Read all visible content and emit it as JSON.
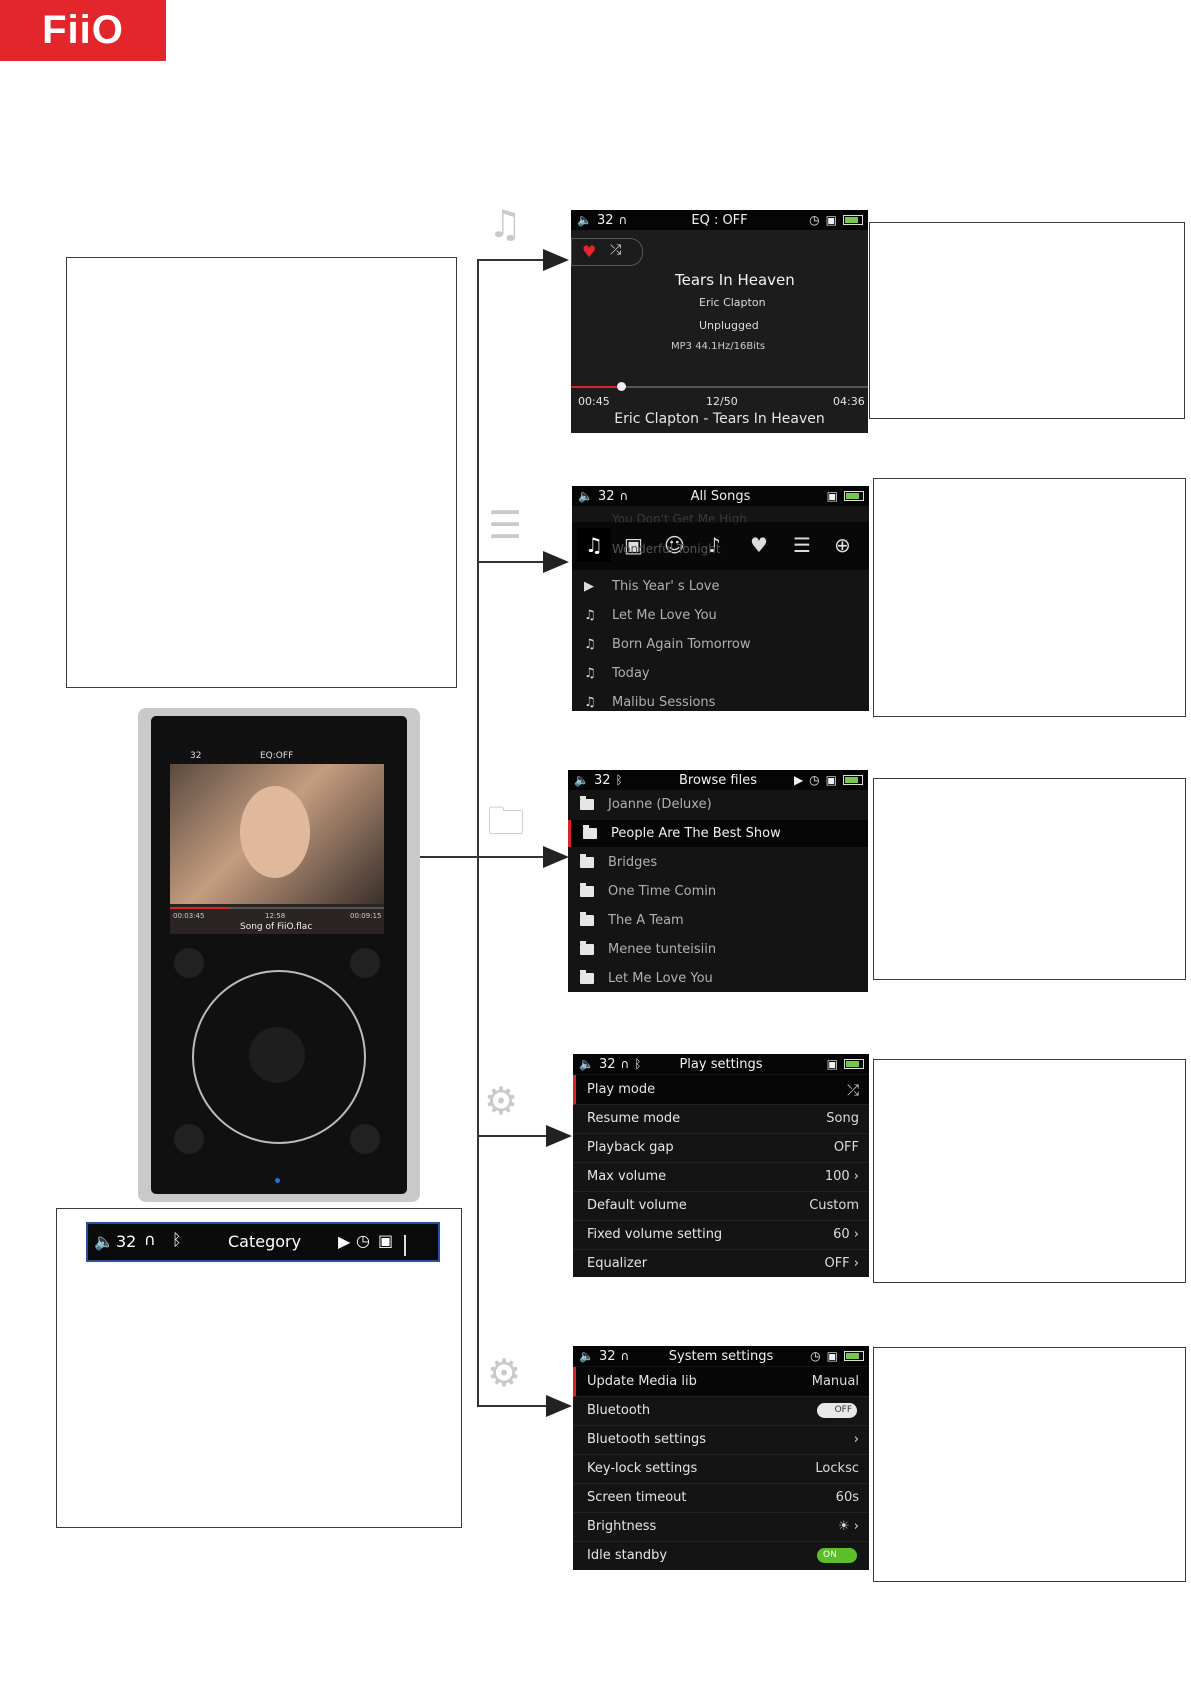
{
  "brand": {
    "logo_text": "FiiO",
    "color": "#e3262c"
  },
  "status_bar_legend": {
    "volume": "32",
    "title": "Category"
  },
  "device_screen": {
    "volume": "32",
    "eq": "EQ:OFF",
    "time_left": "00:03:45",
    "track_pos": "12:58",
    "time_right": "00:09:15",
    "file": "Song of FiiO.flac"
  },
  "now_playing": {
    "volume": "32",
    "title": "EQ : OFF",
    "song": "Tears In Heaven",
    "artist": "Eric Clapton",
    "album": "Unplugged",
    "format": "MP3 44.1Hz/16Bits",
    "elapsed": "00:45",
    "track_index": "12/50",
    "duration": "04:36",
    "now_line": "Eric Clapton - Tears In Heaven",
    "progress_fraction": 0.17
  },
  "all_songs": {
    "volume": "32",
    "title": "All Songs",
    "ghost_top": "You Don't Get Me High",
    "ghost_mid": "Wonderful Tonight",
    "items": [
      "This Year' s Love",
      "Let Me Love You",
      "Born Again Tomorrow",
      "Today",
      "Malibu Sessions"
    ]
  },
  "browse_files": {
    "volume": "32",
    "title": "Browse files",
    "items": [
      "Joanne (Deluxe)",
      "People Are The Best Show",
      "Bridges",
      "One Time Comin",
      "The A Team",
      "Menee tunteisiin",
      "Let Me Love You"
    ],
    "selected_index": 1
  },
  "play_settings": {
    "volume": "32",
    "title": "Play settings",
    "rows": [
      {
        "label": "Play mode",
        "value": ""
      },
      {
        "label": "Resume mode",
        "value": "Song"
      },
      {
        "label": "Playback gap",
        "value": "OFF"
      },
      {
        "label": "Max volume",
        "value": "100  ›"
      },
      {
        "label": "Default volume",
        "value": "Custom"
      },
      {
        "label": "Fixed volume setting",
        "value": "60  ›"
      },
      {
        "label": "Equalizer",
        "value": "OFF  ›"
      }
    ]
  },
  "system_settings": {
    "volume": "32",
    "title": "System settings",
    "rows": [
      {
        "label": "Update Media lib",
        "value": "Manual"
      },
      {
        "label": "Bluetooth",
        "value": "OFF"
      },
      {
        "label": "Bluetooth settings",
        "value": "›"
      },
      {
        "label": "Key-lock settings",
        "value": "Locksc"
      },
      {
        "label": "Screen timeout",
        "value": "60s"
      },
      {
        "label": "Brightness",
        "value": "☀ ›"
      },
      {
        "label": "Idle standby",
        "value": "ON"
      }
    ]
  }
}
